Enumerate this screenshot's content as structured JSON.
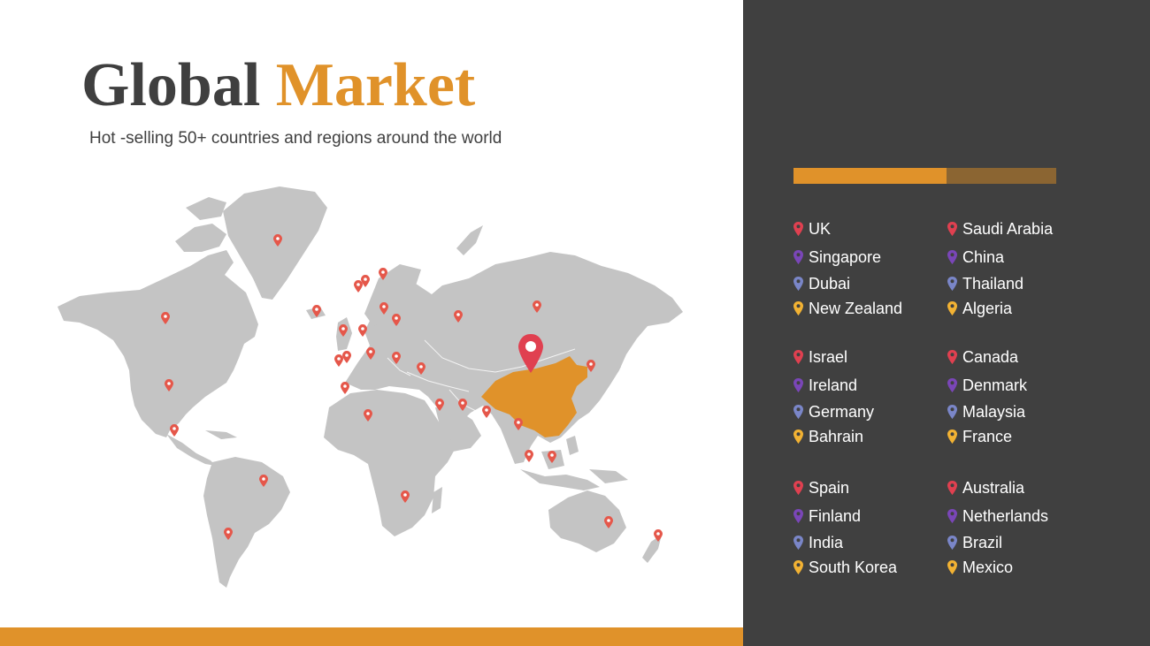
{
  "title": {
    "part1": "Global",
    "part2": "Market"
  },
  "subtitle": "Hot -selling 50+ countries and regions around the world",
  "colors": {
    "accent": "#e0922a",
    "accent_dark": "#8b6532",
    "panel": "#404040",
    "land": "#c4c4c4",
    "highlight": "#e0922a",
    "marker": "#e5574a",
    "pin_red": "#e04050",
    "pin_purple": "#7a46b8",
    "pin_blue": "#7a86c8",
    "pin_yellow": "#f2b233"
  },
  "map": {
    "highlighted_country": "China",
    "main_marker_icon": "map-pin-icon",
    "marker_icon": "map-pin-icon"
  },
  "countries": {
    "groups": [
      {
        "items": [
          {
            "name": "UK",
            "pin": "red"
          },
          {
            "name": "Saudi Arabia",
            "pin": "red"
          },
          {
            "name": "Singapore",
            "pin": "purple"
          },
          {
            "name": "China",
            "pin": "purple"
          },
          {
            "name": "Dubai",
            "pin": "blue"
          },
          {
            "name": "Thailand",
            "pin": "blue"
          },
          {
            "name": "New Zealand",
            "pin": "yellow"
          },
          {
            "name": "Algeria",
            "pin": "yellow"
          }
        ]
      },
      {
        "items": [
          {
            "name": "Israel",
            "pin": "red"
          },
          {
            "name": "Canada",
            "pin": "red"
          },
          {
            "name": "Ireland",
            "pin": "purple"
          },
          {
            "name": "Denmark",
            "pin": "purple"
          },
          {
            "name": "Germany",
            "pin": "blue"
          },
          {
            "name": "Malaysia",
            "pin": "blue"
          },
          {
            "name": "Bahrain",
            "pin": "yellow"
          },
          {
            "name": "France",
            "pin": "yellow"
          }
        ]
      },
      {
        "items": [
          {
            "name": "Spain",
            "pin": "red"
          },
          {
            "name": "Australia",
            "pin": "red"
          },
          {
            "name": "Finland",
            "pin": "purple"
          },
          {
            "name": "Netherlands",
            "pin": "purple"
          },
          {
            "name": "India",
            "pin": "blue"
          },
          {
            "name": "Brazil",
            "pin": "blue"
          },
          {
            "name": "South Korea",
            "pin": "yellow"
          },
          {
            "name": "Mexico",
            "pin": "yellow"
          }
        ]
      }
    ]
  }
}
